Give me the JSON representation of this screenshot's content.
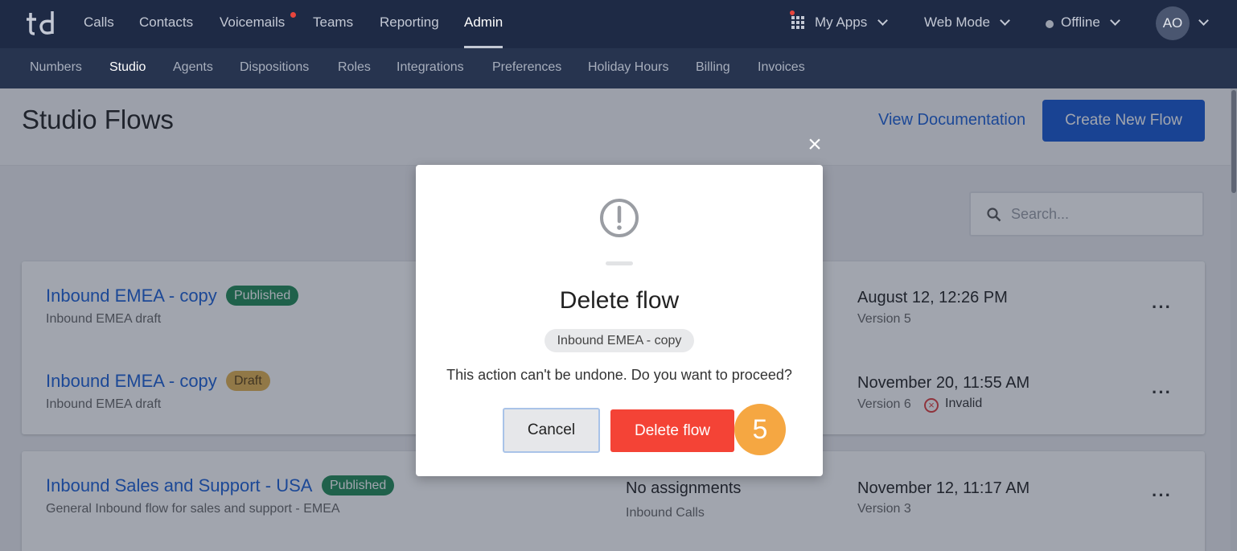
{
  "app": {
    "logo_text": "td"
  },
  "topnav": {
    "items": [
      {
        "label": "Calls"
      },
      {
        "label": "Contacts"
      },
      {
        "label": "Voicemails",
        "has_notification_dot": true
      },
      {
        "label": "Teams"
      },
      {
        "label": "Reporting"
      },
      {
        "label": "Admin",
        "active": true
      }
    ],
    "my_apps_label": "My Apps",
    "mode_label": "Web Mode",
    "status_label": "Offline",
    "avatar_initials": "AO"
  },
  "subnav": {
    "items": [
      {
        "label": "Numbers"
      },
      {
        "label": "Studio",
        "active": true
      },
      {
        "label": "Agents"
      },
      {
        "label": "Dispositions"
      },
      {
        "label": "Roles"
      },
      {
        "label": "Integrations"
      },
      {
        "label": "Preferences"
      },
      {
        "label": "Holiday Hours"
      },
      {
        "label": "Billing"
      },
      {
        "label": "Invoices"
      }
    ]
  },
  "page": {
    "title": "Studio Flows",
    "view_docs_label": "View Documentation",
    "create_flow_label": "Create New Flow",
    "search_placeholder": "Search..."
  },
  "flows": [
    {
      "title": "Inbound EMEA - copy",
      "badge": "Published",
      "description": "Inbound EMEA draft",
      "date": "August 12, 12:26 PM",
      "version": "Version 5"
    },
    {
      "title": "Inbound EMEA - copy",
      "badge": "Draft",
      "description": "Inbound EMEA draft",
      "date": "November 20, 11:55 AM",
      "version": "Version 6",
      "validity": "Invalid"
    },
    {
      "title": "Inbound Sales and Support - USA",
      "badge": "Published",
      "description": "General Inbound flow for sales and support - EMEA",
      "assignment": "No assignments",
      "assignment_type": "Inbound Calls",
      "date": "November 12, 11:17 AM",
      "version": "Version 3"
    }
  ],
  "modal": {
    "title": "Delete flow",
    "flow_name_chip": "Inbound EMEA - copy",
    "message": "This action can't be undone. Do you want to proceed?",
    "cancel_label": "Cancel",
    "delete_label": "Delete flow",
    "close_glyph": "×"
  },
  "step_badge": "5",
  "colors": {
    "nav_bg": "#1e2a45",
    "subnav_bg": "#27344f",
    "primary_blue": "#1557d0",
    "delete_red": "#f44336",
    "published_green": "#1f8a55",
    "draft_yellow": "#e3b24f",
    "step_orange": "#f5a742"
  }
}
